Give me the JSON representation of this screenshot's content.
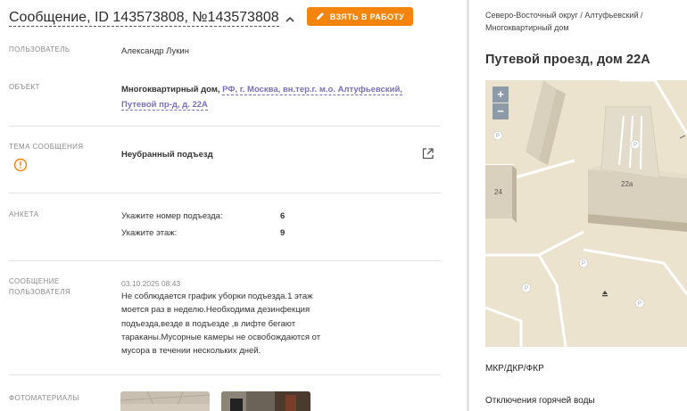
{
  "header": {
    "title": "Сообщение, ID 143573808, №143573808",
    "take_button_label": "ВЗЯТЬ В РАБОТУ"
  },
  "fields": {
    "user_label": "ПОЛЬЗОВАТЕЛЬ",
    "user_value": "Александр Лукин",
    "object_label": "ОБЪЕКТ",
    "object_type": "Многоквартирный дом,",
    "object_address_line1": "РФ, г. Москва, вн.тер.г. м.о. Алтуфьевский,",
    "object_address_line2": "Путевой пр-д, д. 22А",
    "topic_label": "ТЕМА СООБЩЕНИЯ",
    "topic_value": "Неубранный подъезд",
    "survey_label": "АНКЕТА",
    "survey": [
      {
        "question": "Укажите номер подъезда:",
        "answer": "6"
      },
      {
        "question": "Укажите этаж:",
        "answer": "9"
      }
    ],
    "message_label_line1": "СООБЩЕНИЕ",
    "message_label_line2": "ПОЛЬЗОВАТЕЛЯ",
    "message_date": "03.10.2025 08:43",
    "message_lines": [
      "Не соблюдается график уборки подъезда.1 этаж",
      "моется раз в неделю.Необходима дезинфекция",
      "подъезда,везде в подъезде ,в лифте бегают",
      "тараканы.Мусорные камеры не освобождаются от",
      "мусора в течении нескольких дней."
    ],
    "photos_label": "ФОТОМАТЕРИАЛЫ"
  },
  "right_panel": {
    "breadcrumb_line1": "Северо-Восточный округ / Алтуфьевский /",
    "breadcrumb_line2": "Многоквартирный дом",
    "title": "Путевой проезд, дом 22А",
    "map": {
      "zoom_in": "+",
      "zoom_out": "−",
      "building_labels": [
        "24",
        "22а"
      ],
      "parking_symbol": "P"
    },
    "section1": "МКР/ДКР/ФКР",
    "section2": "Отключения горячей воды"
  },
  "colors": {
    "accent_orange": "#f5840c",
    "link_purple": "#7b6fb5",
    "map_base": "#ece3cf"
  },
  "icons": [
    "chevron-up-icon",
    "pencil-icon",
    "warning-circle-icon",
    "external-link-icon"
  ]
}
